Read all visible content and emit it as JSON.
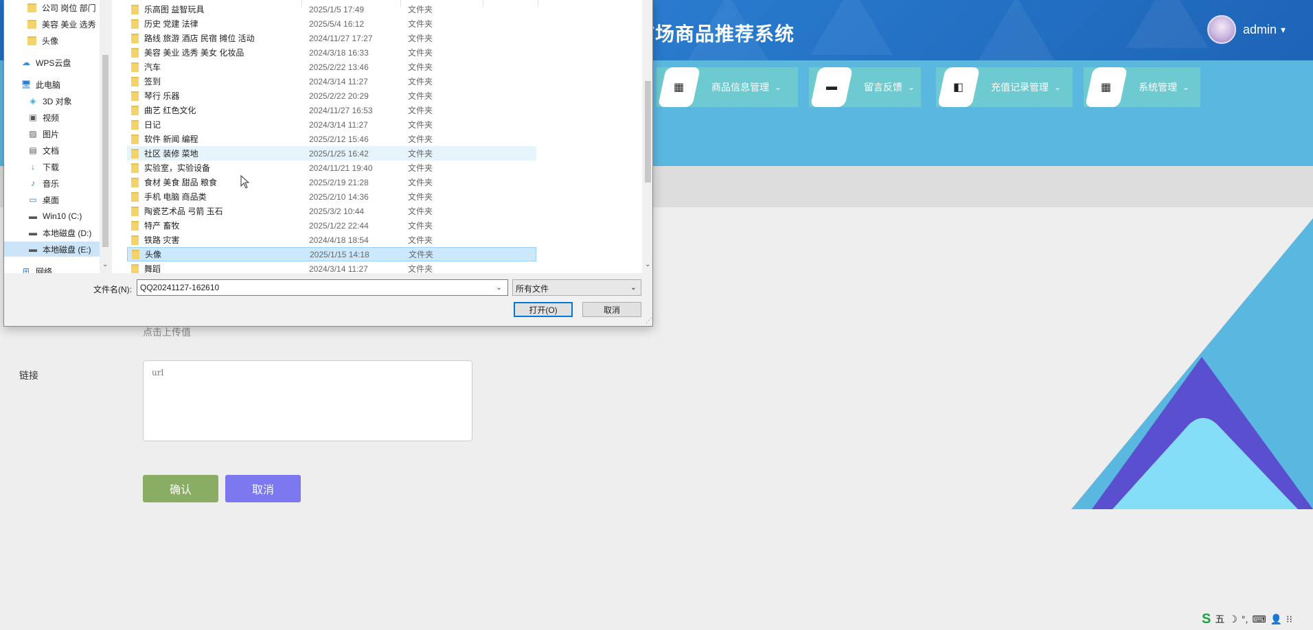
{
  "app": {
    "title": "市场商品推荐系统",
    "user": {
      "name": "admin",
      "caret": "▾"
    },
    "nav": [
      {
        "label": "商品信息管理",
        "icon": "grid-icon",
        "glyph": "▦",
        "caret": "⌄"
      },
      {
        "label": "留言反馈",
        "icon": "briefcase-icon",
        "glyph": "▬",
        "caret": "⌄"
      },
      {
        "label": "充值记录管理",
        "icon": "wallet-icon",
        "glyph": "◧",
        "caret": "⌄"
      },
      {
        "label": "系统管理",
        "icon": "grid-icon",
        "glyph": "▦",
        "caret": "⌄"
      }
    ],
    "form": {
      "upload_hint": "点击上传值",
      "link_label": "链接",
      "link_placeholder": "url",
      "confirm": "确认",
      "cancel": "取消"
    },
    "tray": {
      "ime": "S",
      "items": [
        "五",
        "☽",
        "°,",
        "⌨",
        "👤",
        "⁝⁝"
      ]
    }
  },
  "dialog": {
    "tree": [
      {
        "label": "公司 岗位 部门",
        "icon": "folder-icon"
      },
      {
        "label": "美容 美业 选秀",
        "icon": "folder-icon"
      },
      {
        "label": "头像",
        "icon": "folder-icon"
      },
      {
        "label": "WPS云盘",
        "icon": "cloud-icon",
        "glyph": "☁"
      },
      {
        "label": "此电脑",
        "icon": "computer-icon",
        "glyph": "🖥"
      },
      {
        "label": "3D 对象",
        "icon": "cube-icon",
        "glyph": "◈"
      },
      {
        "label": "视频",
        "icon": "video-icon",
        "glyph": "▣"
      },
      {
        "label": "图片",
        "icon": "picture-icon",
        "glyph": "▨"
      },
      {
        "label": "文档",
        "icon": "document-icon",
        "glyph": "▤"
      },
      {
        "label": "下载",
        "icon": "download-icon",
        "glyph": "↓"
      },
      {
        "label": "音乐",
        "icon": "music-icon",
        "glyph": "♪"
      },
      {
        "label": "桌面",
        "icon": "desktop-icon",
        "glyph": "▭"
      },
      {
        "label": "Win10 (C:)",
        "icon": "drive-icon",
        "glyph": "▬"
      },
      {
        "label": "本地磁盘 (D:)",
        "icon": "drive-icon",
        "glyph": "▬"
      },
      {
        "label": "本地磁盘 (E:)",
        "icon": "drive-icon",
        "glyph": "▬",
        "selected": true
      },
      {
        "label": "网络",
        "icon": "network-icon",
        "glyph": "⊞"
      }
    ],
    "files": [
      {
        "name": "乐高图 益智玩具",
        "date": "2025/1/5 17:49",
        "type": "文件夹"
      },
      {
        "name": "历史  党建  法律",
        "date": "2025/5/4 16:12",
        "type": "文件夹"
      },
      {
        "name": "路线 旅游 酒店 民宿 摊位  活动",
        "date": "2024/11/27 17:27",
        "type": "文件夹"
      },
      {
        "name": "美容 美业 选秀 美女 化妆品",
        "date": "2024/3/18 16:33",
        "type": "文件夹"
      },
      {
        "name": "汽车",
        "date": "2025/2/22 13:46",
        "type": "文件夹"
      },
      {
        "name": "签到",
        "date": "2024/3/14 11:27",
        "type": "文件夹"
      },
      {
        "name": "琴行  乐器",
        "date": "2025/2/22 20:29",
        "type": "文件夹"
      },
      {
        "name": "曲艺  红色文化",
        "date": "2024/11/27 16:53",
        "type": "文件夹"
      },
      {
        "name": "日记",
        "date": "2024/3/14 11:27",
        "type": "文件夹"
      },
      {
        "name": "软件  新闻  编程",
        "date": "2025/2/12 15:46",
        "type": "文件夹"
      },
      {
        "name": "社区  装修  菜地",
        "date": "2025/1/25 16:42",
        "type": "文件夹",
        "state": "hover"
      },
      {
        "name": "实验室，实验设备",
        "date": "2024/11/21 19:40",
        "type": "文件夹"
      },
      {
        "name": "食材 美食 甜品 粮食",
        "date": "2025/2/19 21:28",
        "type": "文件夹"
      },
      {
        "name": "手机 电脑  商品类",
        "date": "2025/2/10 14:36",
        "type": "文件夹"
      },
      {
        "name": "陶瓷艺术品  弓箭  玉石",
        "date": "2025/3/2 10:44",
        "type": "文件夹"
      },
      {
        "name": "特产  畜牧",
        "date": "2025/1/22 22:44",
        "type": "文件夹"
      },
      {
        "name": "铁路  灾害",
        "date": "2024/4/18 18:54",
        "type": "文件夹"
      },
      {
        "name": "头像",
        "date": "2025/1/15 14:18",
        "type": "文件夹",
        "state": "selected"
      },
      {
        "name": "舞蹈",
        "date": "2024/3/14 11:27",
        "type": "文件夹"
      }
    ],
    "filename_label": "文件名(N):",
    "filename_value": "QQ20241127-162610",
    "filetype": "所有文件",
    "open": "打开(O)",
    "cancel": "取消",
    "colors": {
      "selection": "#cce8ff",
      "hover": "#e5f3fb",
      "primary_border": "#0078d7"
    }
  }
}
